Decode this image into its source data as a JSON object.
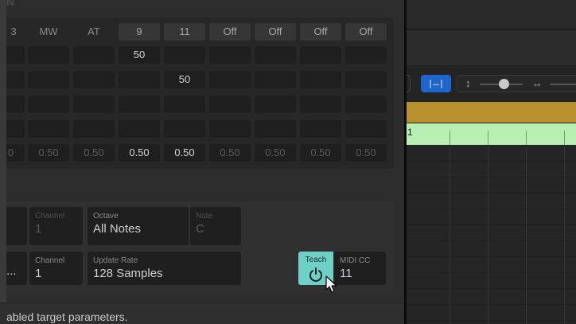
{
  "midi_grid": {
    "header_partial": "3",
    "headers": [
      "MW",
      "AT",
      "9",
      "11",
      "Off",
      "Off",
      "Off",
      "Off"
    ],
    "row1_value": "50",
    "row2_value": "50",
    "bottom_row": {
      "partial": "0",
      "values": [
        "0.50",
        "0.50",
        "0.50",
        "0.50",
        "0.50",
        "0.50",
        "0.50",
        "0.50"
      ]
    }
  },
  "assignment": {
    "row1": {
      "channel_label": "Channel",
      "channel_value": "1",
      "octave_label": "Octave",
      "octave_value": "All Notes",
      "note_label": "Note",
      "note_value": "C"
    },
    "row2": {
      "partial_value": "...",
      "channel_label": "Channel",
      "channel_value": "1",
      "update_rate_label": "Update Rate",
      "update_rate_value": "128 Samples",
      "teach_label": "Teach",
      "midi_cc_label": "MIDI CC",
      "midi_cc_value": "11"
    }
  },
  "status": {
    "text": "abled target parameters."
  },
  "track_area": {
    "region_label": "1"
  },
  "colors": {
    "teach_active": "#6fd0c8",
    "toolbar_button_blue": "#1f66cc",
    "region_gold": "#b8902e",
    "region_green": "#b8f0b3"
  }
}
